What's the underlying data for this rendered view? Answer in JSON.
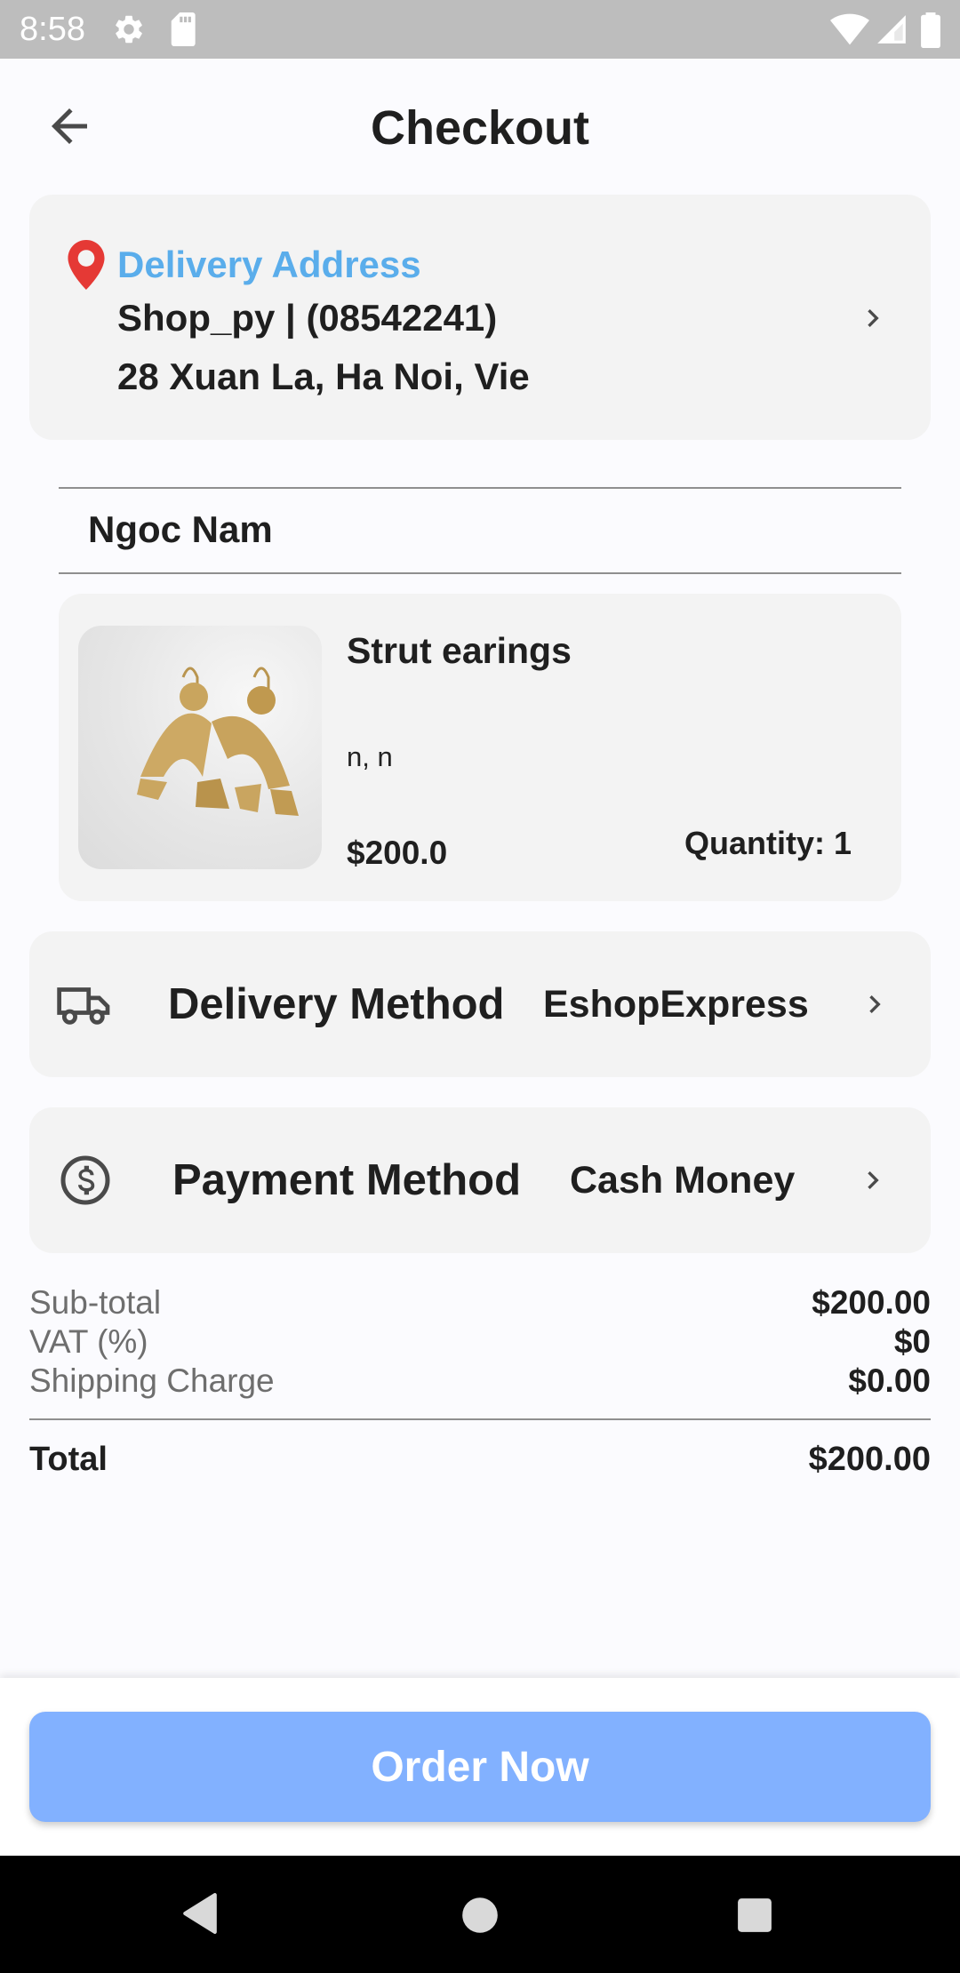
{
  "status_bar": {
    "time": "8:58",
    "icons": [
      "settings-icon",
      "sd-card-icon",
      "wifi-icon",
      "signal-icon",
      "battery-icon"
    ]
  },
  "header": {
    "title": "Checkout",
    "back_icon": "arrow-back-icon"
  },
  "address": {
    "label": "Delivery Address",
    "name_phone": "Shop_py | (08542241)",
    "street": "28 Xuan La, Ha Noi, Vie",
    "icon": "location-pin-icon"
  },
  "shop": {
    "name": "Ngoc Nam"
  },
  "item": {
    "name": "Strut earings",
    "variant": "n, n",
    "price": "$200.0",
    "quantity": "Quantity: 1"
  },
  "delivery": {
    "title": "Delivery Method",
    "value": "EshopExpress",
    "icon": "truck-icon"
  },
  "payment": {
    "title": "Payment Method",
    "value": "Cash Money",
    "icon": "dollar-circle-icon"
  },
  "summary": {
    "subtotal_label": "Sub-total",
    "subtotal_value": "$200.00",
    "vat_label": "VAT (%)",
    "vat_value": "$0",
    "shipping_label": "Shipping Charge",
    "shipping_value": "$0.00",
    "total_label": "Total",
    "total_value": "$200.00"
  },
  "order_button": {
    "label": "Order Now"
  },
  "colors": {
    "accent_blue": "#5AADEB",
    "button_blue": "#82B1FF",
    "pin_red": "#E53935"
  }
}
